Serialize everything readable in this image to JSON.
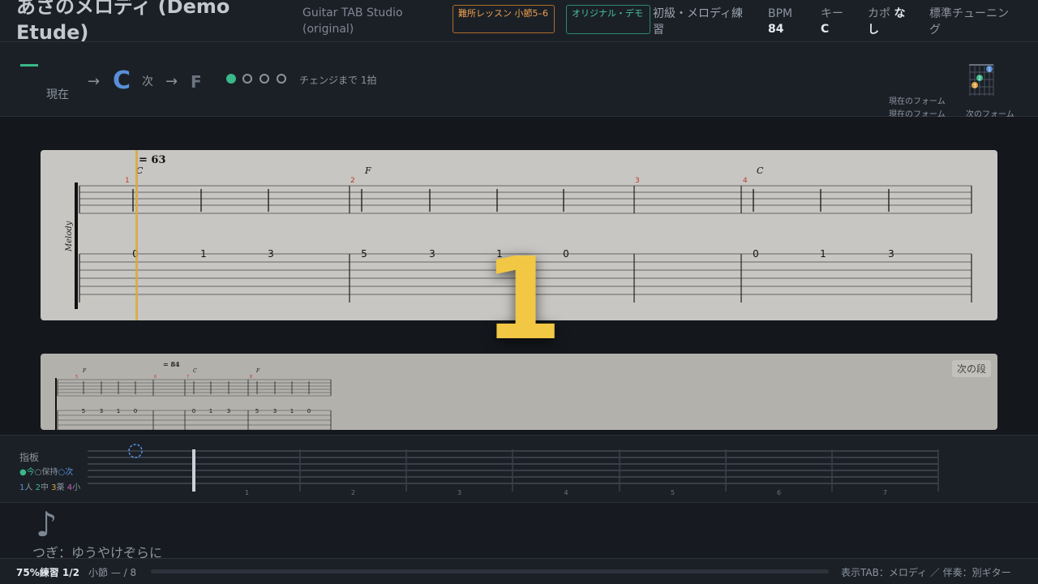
{
  "header": {
    "song_title": "あさのメロディ (Demo Etude)",
    "app_name": "Guitar TAB Studio (original)",
    "badge_difficult": "難所レッスン 小節5–6",
    "badge_original": "オリジナル・デモ",
    "level": "初級・メロディ練習",
    "bpm_label": "BPM",
    "bpm_value": "84",
    "key_label": "キー",
    "key_value": "C",
    "capo_label": "カポ",
    "capo_value": "なし",
    "tuning": "標準チューニング"
  },
  "chord_bar": {
    "current_label": "現在",
    "arrow": "→",
    "current_chord": "C",
    "next_label": "次",
    "next_chord": "F",
    "change_text": "チェンジまで 1拍",
    "beats_total": 4,
    "beats_filled": 1,
    "form_current_1": "現在のフォーム",
    "form_current_2": "現在のフォーム",
    "form_next": "次のフォーム",
    "form_fingers": [
      "1",
      "2",
      "3"
    ]
  },
  "score": {
    "tempo": "= 63",
    "staff_label": "Melody",
    "measures": [
      {
        "number": "1",
        "chord": "C",
        "frets": [
          "0",
          "1",
          "3"
        ]
      },
      {
        "number": "2",
        "chord": "F",
        "frets": [
          "5",
          "3",
          "1",
          "0"
        ]
      },
      {
        "number": "3",
        "chord": "",
        "frets": []
      },
      {
        "number": "4",
        "chord": "C",
        "frets": [
          "0",
          "1",
          "3"
        ]
      }
    ],
    "countdown": "1",
    "next_section_button": "次の段",
    "next_line": {
      "tempo": "= 84",
      "measures": [
        {
          "number": "5",
          "chord": "F",
          "frets": [
            "5",
            "3",
            "1",
            "0"
          ]
        },
        {
          "number": "6",
          "chord": "",
          "frets": []
        },
        {
          "number": "7",
          "chord": "C",
          "frets": [
            "0",
            "1",
            "3"
          ]
        },
        {
          "number": "8",
          "chord": "F",
          "frets": [
            "5",
            "3",
            "1",
            "0"
          ]
        }
      ]
    }
  },
  "fretboard": {
    "title": "指板",
    "legend_now": "●今",
    "legend_hold": "○保持",
    "legend_next": "○次",
    "fingers": [
      {
        "num": "1",
        "name": "人",
        "color": "#5a8fd8"
      },
      {
        "num": "2",
        "name": "中",
        "color": "#3ab889"
      },
      {
        "num": "3",
        "name": "薬",
        "color": "#e0a040"
      },
      {
        "num": "4",
        "name": "小",
        "color": "#d060c0"
      }
    ],
    "fret_numbers": [
      "1",
      "2",
      "3",
      "4",
      "5",
      "6",
      "7"
    ]
  },
  "lyric": {
    "note_symbol": "♪",
    "next_lyric": "つぎ：ゆうやけぞらに"
  },
  "footer": {
    "practice": "75%練習 1/2",
    "measure": "小節 — / 8",
    "progress": 0,
    "display_info": "表示TAB：メロディ ／ 伴奏：別ギター"
  }
}
